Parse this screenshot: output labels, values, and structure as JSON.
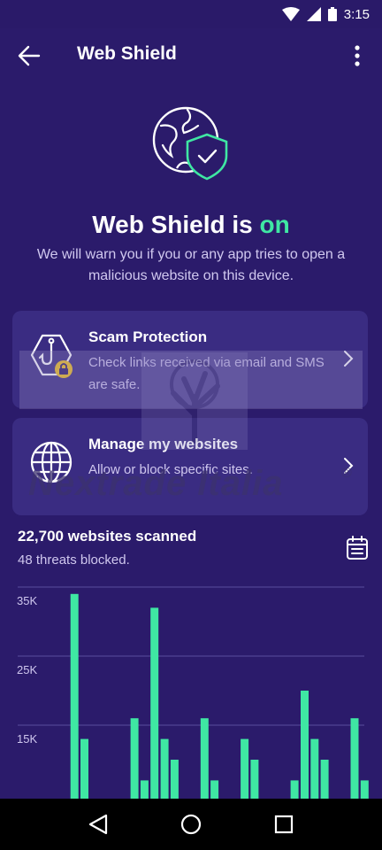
{
  "status_bar": {
    "time": "3:15",
    "icons": [
      "wifi-icon",
      "signal-icon",
      "battery-icon"
    ]
  },
  "app_bar": {
    "title": "Web Shield",
    "back_icon": "arrow-left-icon",
    "menu_icon": "more-vertical-icon"
  },
  "hero": {
    "icon": "globe-shield-icon",
    "title_prefix": "Web Shield is ",
    "title_state": "on",
    "description": "We will warn you if you or any app tries to open a malicious website on this device."
  },
  "cards": [
    {
      "title": "Scam Protection",
      "description": "Check links received via email and SMS are safe.",
      "icon": "hook-lock-icon"
    },
    {
      "title": "Manage my websites",
      "description": "Allow or block specific sites.",
      "icon": "globe-icon"
    }
  ],
  "watermark": {
    "text": "Nextrade Italia",
    "mark": "®"
  },
  "stats": {
    "title": "22,700 websites scanned",
    "subtitle": "48 threats blocked.",
    "calendar_icon": "calendar-icon"
  },
  "chart_data": {
    "type": "bar",
    "y_ticks": [
      "35K",
      "25K",
      "15K"
    ],
    "ylim": [
      0,
      37000
    ],
    "values": [
      0,
      0,
      0,
      0,
      0,
      34000,
      13000,
      0,
      0,
      0,
      0,
      16000,
      7000,
      32000,
      13000,
      10000,
      0,
      0,
      16000,
      7000,
      0,
      0,
      13000,
      10000,
      0,
      0,
      0,
      7000,
      20000,
      13000,
      10000,
      0,
      0,
      16000,
      7000
    ]
  },
  "colors": {
    "background": "#2b1b6b",
    "card": "#3a2c82",
    "accent": "#3fe7a3",
    "bar": "#3fe7a3"
  },
  "nav_bar": {
    "icons": [
      "back-triangle-icon",
      "home-circle-icon",
      "recents-square-icon"
    ]
  }
}
